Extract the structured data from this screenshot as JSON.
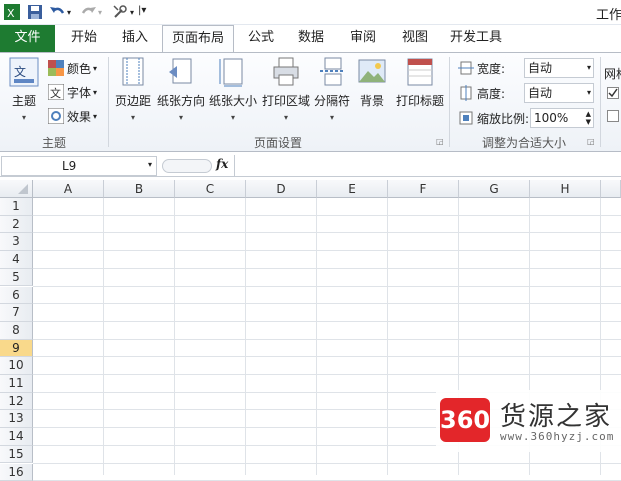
{
  "app": {
    "title": "工作"
  },
  "ribbon_tabs": [
    "文件",
    "开始",
    "插入",
    "页面布局",
    "公式",
    "数据",
    "审阅",
    "视图",
    "开发工具"
  ],
  "ribbon_active_tab": "页面布局",
  "theme_group": {
    "label": "主题",
    "themes_button": "主题",
    "colors": "颜色",
    "fonts": "字体",
    "effects": "效果"
  },
  "page_setup_group": {
    "label": "页面设置",
    "margins": "页边距",
    "orientation": "纸张方向",
    "size": "纸张大小",
    "print_area": "打印区域",
    "breaks": "分隔符",
    "background": "背景",
    "print_titles": "打印标题"
  },
  "scale_group": {
    "label": "调整为合适大小",
    "width_label": "宽度:",
    "width_value": "自动",
    "height_label": "高度:",
    "height_value": "自动",
    "scale_label": "缩放比例:",
    "scale_value": "100%"
  },
  "sheet_options": {
    "label": "网格"
  },
  "formula_bar": {
    "name_box": "L9",
    "fx": "fx"
  },
  "columns": [
    "A",
    "B",
    "C",
    "D",
    "E",
    "F",
    "G",
    "H"
  ],
  "rows": [
    "1",
    "2",
    "3",
    "4",
    "5",
    "6",
    "7",
    "8",
    "9",
    "10",
    "11",
    "12",
    "13",
    "14",
    "15",
    "16"
  ],
  "selected_row": "9",
  "watermark": {
    "logo": "360",
    "name": "货源之家",
    "url": "www.360hyzj.com"
  }
}
